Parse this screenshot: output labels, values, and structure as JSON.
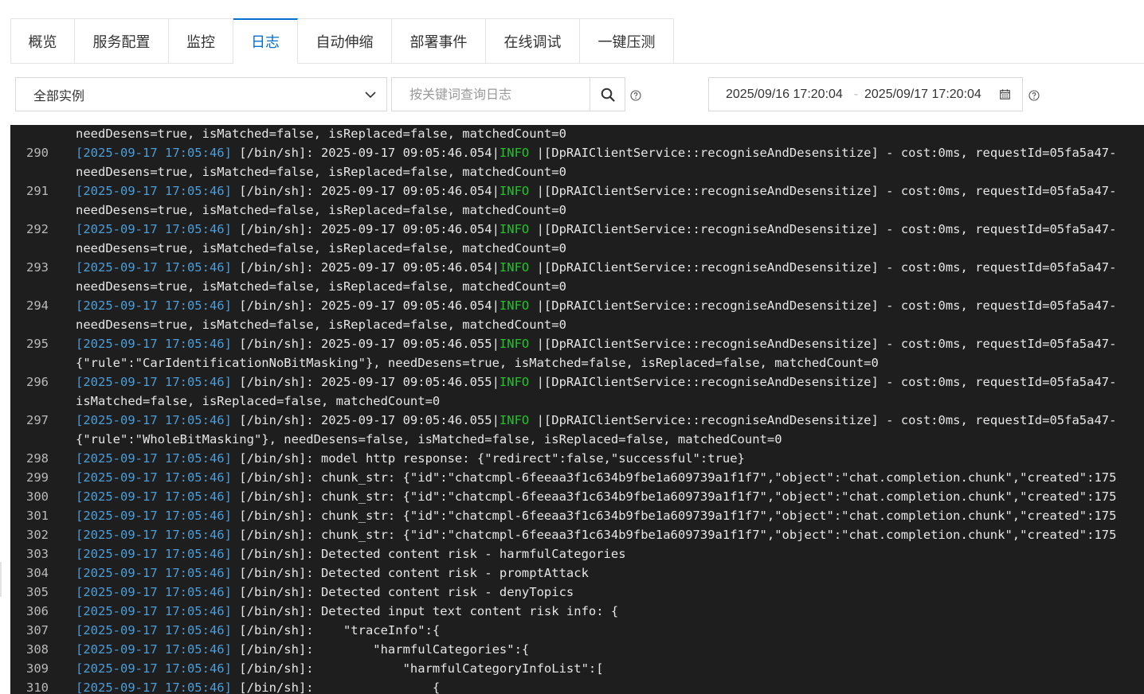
{
  "tabs": [
    {
      "label": "概览",
      "active": false
    },
    {
      "label": "服务配置",
      "active": false
    },
    {
      "label": "监控",
      "active": false
    },
    {
      "label": "日志",
      "active": true
    },
    {
      "label": "自动伸缩",
      "active": false
    },
    {
      "label": "部署事件",
      "active": false
    },
    {
      "label": "在线调试",
      "active": false
    },
    {
      "label": "一键压测",
      "active": false
    }
  ],
  "filters": {
    "instance_select": "全部实例",
    "search_placeholder": "按关键词查询日志",
    "date_start": "2025/09/16 17:20:04",
    "date_separator": "-",
    "date_end": "2025/09/17 17:20:04"
  },
  "colors": {
    "accent": "#0070cc",
    "timestamp": "#4a9eda",
    "info": "#22c22c",
    "log_bg": "#1e1e1e"
  },
  "log": {
    "lines": [
      {
        "n": "",
        "parts": [
          {
            "t": "needDesens=true, isMatched=false, isReplaced=false, matchedCount=0"
          }
        ]
      },
      {
        "n": "290",
        "parts": [
          {
            "t": "[2025-09-17 17:05:46]",
            "c": "ts"
          },
          {
            "t": " [/bin/sh]: 2025-09-17 09:05:46.054|"
          },
          {
            "t": "INFO",
            "c": "lvl"
          },
          {
            "t": " |[DpRAIClientService::recogniseAndDesensitize] - cost:0ms, requestId=05fa5a47-"
          }
        ]
      },
      {
        "n": "",
        "parts": [
          {
            "t": "needDesens=true, isMatched=false, isReplaced=false, matchedCount=0"
          }
        ]
      },
      {
        "n": "291",
        "parts": [
          {
            "t": "[2025-09-17 17:05:46]",
            "c": "ts"
          },
          {
            "t": " [/bin/sh]: 2025-09-17 09:05:46.054|"
          },
          {
            "t": "INFO",
            "c": "lvl"
          },
          {
            "t": " |[DpRAIClientService::recogniseAndDesensitize] - cost:0ms, requestId=05fa5a47-"
          }
        ]
      },
      {
        "n": "",
        "parts": [
          {
            "t": "needDesens=true, isMatched=false, isReplaced=false, matchedCount=0"
          }
        ]
      },
      {
        "n": "292",
        "parts": [
          {
            "t": "[2025-09-17 17:05:46]",
            "c": "ts"
          },
          {
            "t": " [/bin/sh]: 2025-09-17 09:05:46.054|"
          },
          {
            "t": "INFO",
            "c": "lvl"
          },
          {
            "t": " |[DpRAIClientService::recogniseAndDesensitize] - cost:0ms, requestId=05fa5a47-"
          }
        ]
      },
      {
        "n": "",
        "parts": [
          {
            "t": "needDesens=true, isMatched=false, isReplaced=false, matchedCount=0"
          }
        ]
      },
      {
        "n": "293",
        "parts": [
          {
            "t": "[2025-09-17 17:05:46]",
            "c": "ts"
          },
          {
            "t": " [/bin/sh]: 2025-09-17 09:05:46.054|"
          },
          {
            "t": "INFO",
            "c": "lvl"
          },
          {
            "t": " |[DpRAIClientService::recogniseAndDesensitize] - cost:0ms, requestId=05fa5a47-"
          }
        ]
      },
      {
        "n": "",
        "parts": [
          {
            "t": "needDesens=true, isMatched=false, isReplaced=false, matchedCount=0"
          }
        ]
      },
      {
        "n": "294",
        "parts": [
          {
            "t": "[2025-09-17 17:05:46]",
            "c": "ts"
          },
          {
            "t": " [/bin/sh]: 2025-09-17 09:05:46.054|"
          },
          {
            "t": "INFO",
            "c": "lvl"
          },
          {
            "t": " |[DpRAIClientService::recogniseAndDesensitize] - cost:0ms, requestId=05fa5a47-"
          }
        ]
      },
      {
        "n": "",
        "parts": [
          {
            "t": "needDesens=true, isMatched=false, isReplaced=false, matchedCount=0"
          }
        ]
      },
      {
        "n": "295",
        "parts": [
          {
            "t": "[2025-09-17 17:05:46]",
            "c": "ts"
          },
          {
            "t": " [/bin/sh]: 2025-09-17 09:05:46.055|"
          },
          {
            "t": "INFO",
            "c": "lvl"
          },
          {
            "t": " |[DpRAIClientService::recogniseAndDesensitize] - cost:0ms, requestId=05fa5a47-"
          }
        ]
      },
      {
        "n": "",
        "parts": [
          {
            "t": "{\"rule\":\"CarIdentificationNoBitMasking\"}, needDesens=true, isMatched=false, isReplaced=false, matchedCount=0"
          }
        ]
      },
      {
        "n": "296",
        "parts": [
          {
            "t": "[2025-09-17 17:05:46]",
            "c": "ts"
          },
          {
            "t": " [/bin/sh]: 2025-09-17 09:05:46.055|"
          },
          {
            "t": "INFO",
            "c": "lvl"
          },
          {
            "t": " |[DpRAIClientService::recogniseAndDesensitize] - cost:0ms, requestId=05fa5a47-"
          }
        ]
      },
      {
        "n": "",
        "parts": [
          {
            "t": "isMatched=false, isReplaced=false, matchedCount=0"
          }
        ]
      },
      {
        "n": "297",
        "parts": [
          {
            "t": "[2025-09-17 17:05:46]",
            "c": "ts"
          },
          {
            "t": " [/bin/sh]: 2025-09-17 09:05:46.055|"
          },
          {
            "t": "INFO",
            "c": "lvl"
          },
          {
            "t": " |[DpRAIClientService::recogniseAndDesensitize] - cost:0ms, requestId=05fa5a47-"
          }
        ]
      },
      {
        "n": "",
        "parts": [
          {
            "t": "{\"rule\":\"WholeBitMasking\"}, needDesens=false, isMatched=false, isReplaced=false, matchedCount=0"
          }
        ]
      },
      {
        "n": "298",
        "parts": [
          {
            "t": "[2025-09-17 17:05:46]",
            "c": "ts"
          },
          {
            "t": " [/bin/sh]: model http response: {\"redirect\":false,\"successful\":true}"
          }
        ]
      },
      {
        "n": "299",
        "parts": [
          {
            "t": "[2025-09-17 17:05:46]",
            "c": "ts"
          },
          {
            "t": " [/bin/sh]: chunk_str: {\"id\":\"chatcmpl-6feeaa3f1c634b9fbe1a609739a1f1f7\",\"object\":\"chat.completion.chunk\",\"created\":175"
          }
        ]
      },
      {
        "n": "300",
        "parts": [
          {
            "t": "[2025-09-17 17:05:46]",
            "c": "ts"
          },
          {
            "t": " [/bin/sh]: chunk_str: {\"id\":\"chatcmpl-6feeaa3f1c634b9fbe1a609739a1f1f7\",\"object\":\"chat.completion.chunk\",\"created\":175"
          }
        ]
      },
      {
        "n": "301",
        "parts": [
          {
            "t": "[2025-09-17 17:05:46]",
            "c": "ts"
          },
          {
            "t": " [/bin/sh]: chunk_str: {\"id\":\"chatcmpl-6feeaa3f1c634b9fbe1a609739a1f1f7\",\"object\":\"chat.completion.chunk\",\"created\":175"
          }
        ]
      },
      {
        "n": "302",
        "parts": [
          {
            "t": "[2025-09-17 17:05:46]",
            "c": "ts"
          },
          {
            "t": " [/bin/sh]: chunk_str: {\"id\":\"chatcmpl-6feeaa3f1c634b9fbe1a609739a1f1f7\",\"object\":\"chat.completion.chunk\",\"created\":175"
          }
        ]
      },
      {
        "n": "303",
        "parts": [
          {
            "t": "[2025-09-17 17:05:46]",
            "c": "ts"
          },
          {
            "t": " [/bin/sh]: Detected content risk - harmfulCategories"
          }
        ]
      },
      {
        "n": "304",
        "parts": [
          {
            "t": "[2025-09-17 17:05:46]",
            "c": "ts"
          },
          {
            "t": " [/bin/sh]: Detected content risk - promptAttack"
          }
        ]
      },
      {
        "n": "305",
        "parts": [
          {
            "t": "[2025-09-17 17:05:46]",
            "c": "ts"
          },
          {
            "t": " [/bin/sh]: Detected content risk - denyTopics"
          }
        ]
      },
      {
        "n": "306",
        "parts": [
          {
            "t": "[2025-09-17 17:05:46]",
            "c": "ts"
          },
          {
            "t": " [/bin/sh]: Detected input text content risk info: {"
          }
        ]
      },
      {
        "n": "307",
        "parts": [
          {
            "t": "[2025-09-17 17:05:46]",
            "c": "ts"
          },
          {
            "t": " [/bin/sh]:    \"traceInfo\":{"
          }
        ]
      },
      {
        "n": "308",
        "parts": [
          {
            "t": "[2025-09-17 17:05:46]",
            "c": "ts"
          },
          {
            "t": " [/bin/sh]:        \"harmfulCategories\":{"
          }
        ]
      },
      {
        "n": "309",
        "parts": [
          {
            "t": "[2025-09-17 17:05:46]",
            "c": "ts"
          },
          {
            "t": " [/bin/sh]:            \"harmfulCategoryInfoList\":["
          }
        ]
      },
      {
        "n": "310",
        "parts": [
          {
            "t": "[2025-09-17 17:05:46]",
            "c": "ts"
          },
          {
            "t": " [/bin/sh]:                {"
          }
        ]
      }
    ]
  }
}
